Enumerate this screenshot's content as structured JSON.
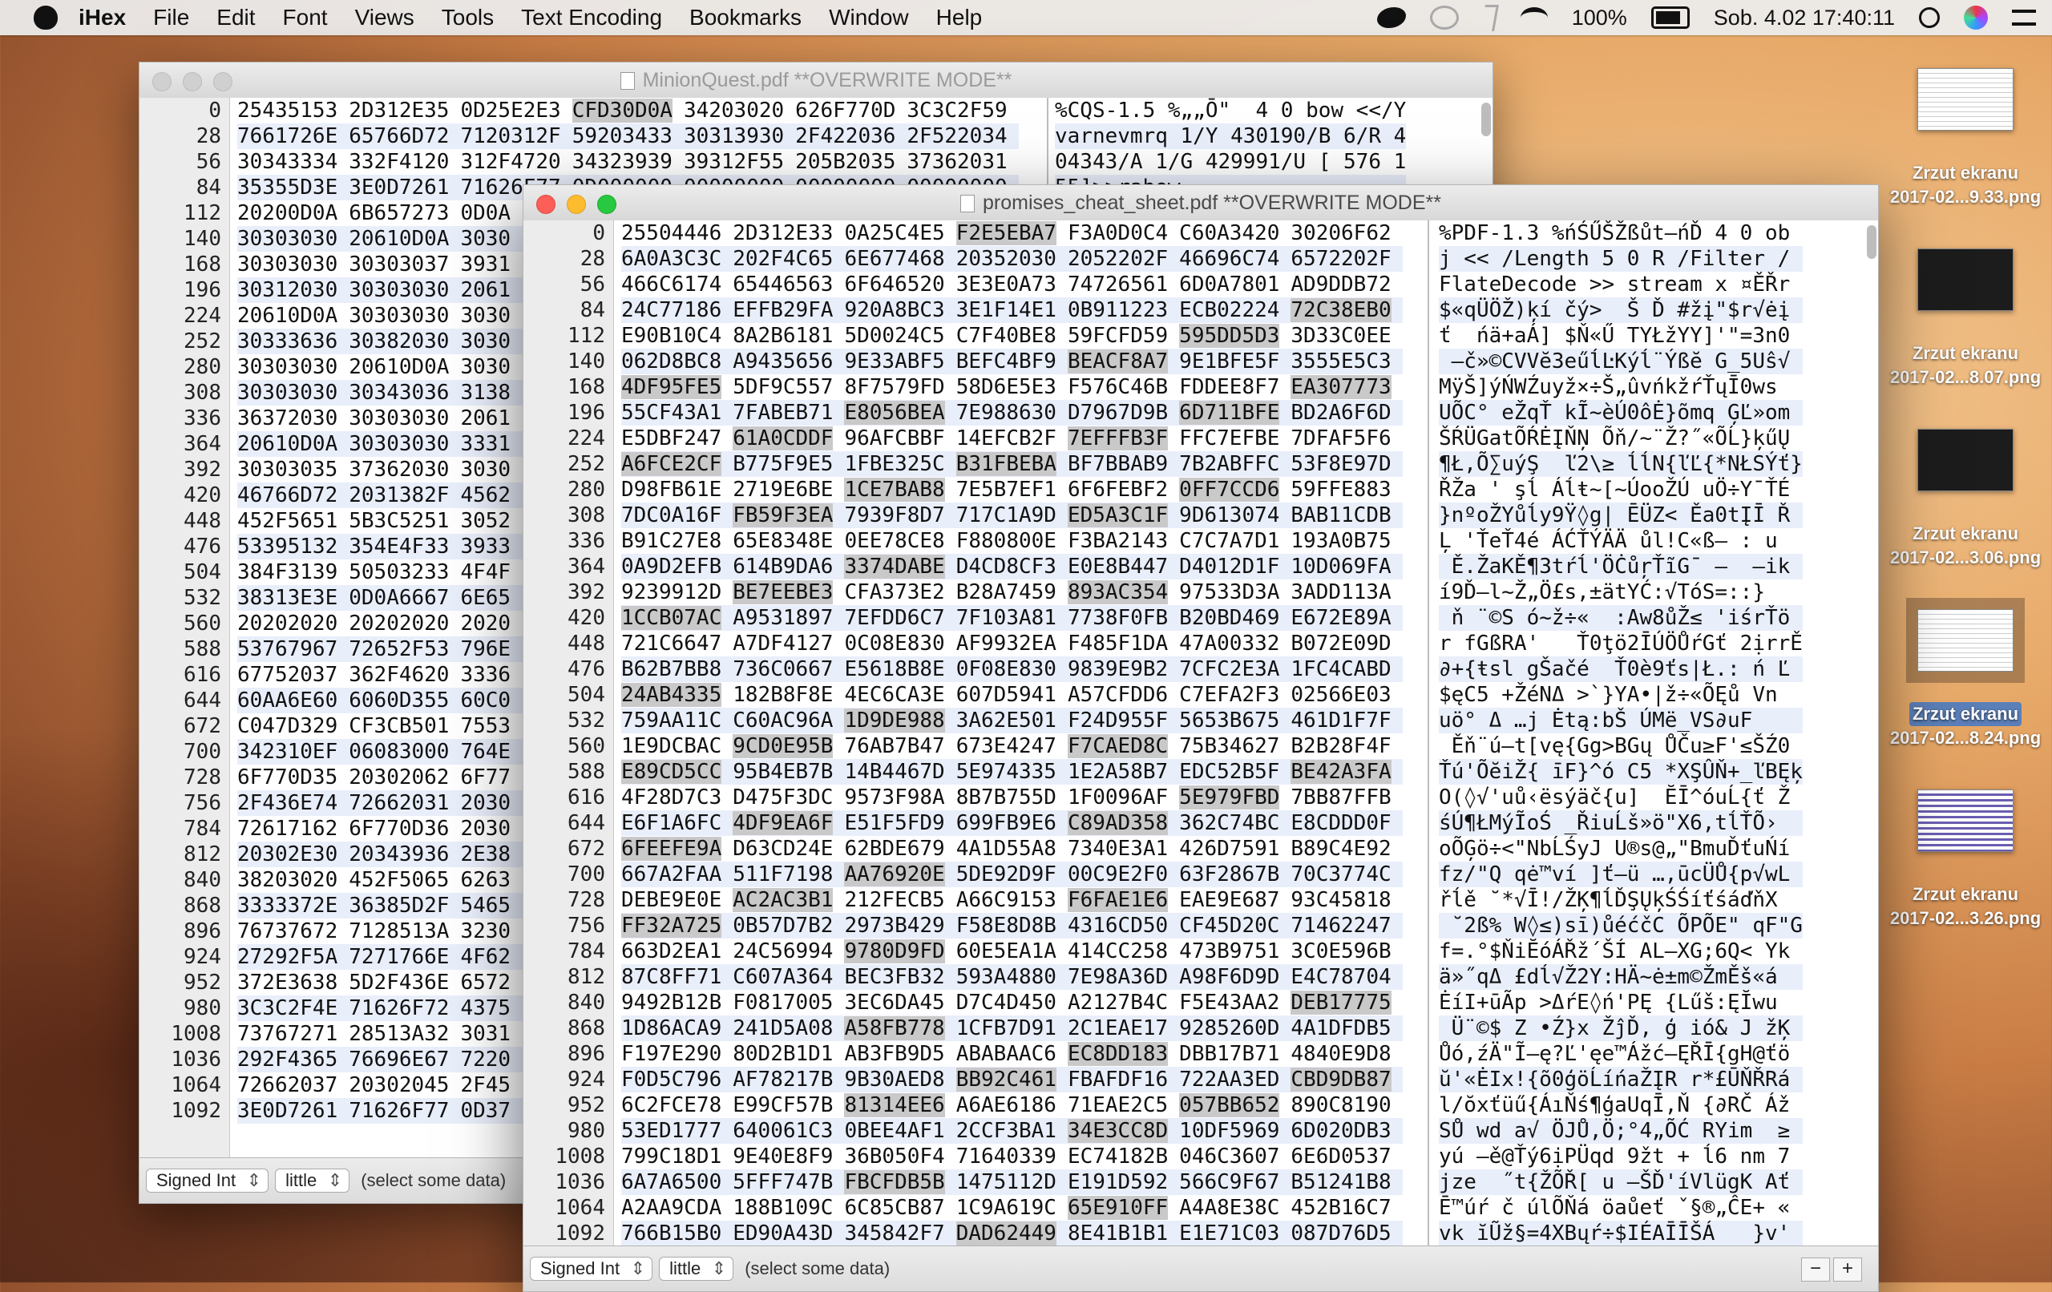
{
  "menubar": {
    "app": "iHex",
    "items": [
      "File",
      "Edit",
      "Font",
      "Views",
      "Tools",
      "Text Encoding",
      "Bookmarks",
      "Window",
      "Help"
    ],
    "battery": "100%",
    "clock": "Sob. 4.02  17:40:11"
  },
  "back_window": {
    "title": "MinionQuest.pdf **OVERWRITE MODE**",
    "offsets": [
      "0",
      "28",
      "56",
      "84",
      "112",
      "140",
      "168",
      "196",
      "224",
      "252",
      "280",
      "308",
      "336",
      "364",
      "392",
      "420",
      "448",
      "476",
      "504",
      "532",
      "560",
      "588",
      "616",
      "644",
      "672",
      "700",
      "728",
      "756",
      "784",
      "812",
      "840",
      "868",
      "896",
      "924",
      "952",
      "980",
      "1008",
      "1036",
      "1064",
      "1092"
    ],
    "hex_rows": [
      "25435153 2D312E35 0D25E2E3 CFD30D0A 34203020 626F770D 3C3C2F59",
      "7661726E 65766D72 7120312F 59203433 30313930 2F422036 2F522034",
      "30343334 332F4120 312F4720 34323939 39312F55 205B2035 37362031",
      "35355D3E 3E0D7261 71626F77 0D000000 00000000 00000000 00000000",
      "20200D0A 6B657273 0D0A",
      "30303030 20610D0A 3030",
      "30303030 30303037 3931",
      "30312030 30303030 2061",
      "20610D0A 30303030 3030",
      "30333636 30382030 3030",
      "30303030 20610D0A 3030",
      "30303030 30343036 3138",
      "36372030 30303030 2061",
      "20610D0A 30303030 3331",
      "30303035 37362030 3030",
      "46766D72 2031382F 4562",
      "452F5651 5B3C5251 3052",
      "53395132 354E4F33 3933",
      "384F3139 50503233 4F4F",
      "38313E3E 0D0A6667 6E65",
      "20202020 20202020 2020",
      "53767967 72652F53 796E",
      "67752037 362F4620 3336",
      "60AA6E60 6060D355 60C0",
      "C047D329 CF3CB501 7553",
      "342310EF 06083000 764E",
      "6F770D35 20302062 6F77",
      "2F436E74 72662031 2030",
      "72617162 6F770D36 2030",
      "20302E30 20343936 2E38",
      "38203020 452F5065 6263",
      "3333372E 36385D2F 5465",
      "76737672 7128513A 3230",
      "27292F5A 7271766E 4F62",
      "372E3638 5D2F436E 6572",
      "3C3C2F4E 71626F72 4375",
      "73767271 28513A32 3031",
      "292F4365 76696E67 7220",
      "72662037 20302045 2F45",
      "3E0D7261 71626F77 0D37"
    ],
    "text_rows": [
      "%CQS-1.5 %„„Ō\"  4 0 bow <</Y",
      "varnevmrq 1/Y 430190/B 6/R 4",
      "04343/A 1/G 429991/U [ 576 1",
      "55]>>rabow"
    ],
    "type_popup": "Signed Int",
    "endian_popup": "little",
    "status": "(select some data)"
  },
  "front_window": {
    "title": "promises_cheat_sheet.pdf **OVERWRITE MODE**",
    "offsets": [
      "0",
      "28",
      "56",
      "84",
      "112",
      "140",
      "168",
      "196",
      "224",
      "252",
      "280",
      "308",
      "336",
      "364",
      "392",
      "420",
      "448",
      "476",
      "504",
      "532",
      "560",
      "588",
      "616",
      "644",
      "672",
      "700",
      "728",
      "756",
      "784",
      "812",
      "840",
      "868",
      "896",
      "924",
      "952",
      "980",
      "1008",
      "1036",
      "1064",
      "1092"
    ],
    "hex_rows": [
      "25504446 2D312E33 0A25C4E5 F2E5EBA7 F3A0D0C4 C60A3420 30206F62",
      "6A0A3C3C 202F4C65 6E677468 20352030 2052202F 46696C74 6572202F",
      "466C6174 65446563 6F646520 3E3E0A73 74726561 6D0A7801 AD9DDB72",
      "24C77186 EFFB29FA 920A8BC3 3E1F14E1 0B911223 ECB02224 72C38EB0",
      "E90B10C4 8A2B6181 5D0024C5 C7F40BE8 59FCFD59 595DD5D3 3D33C0EE",
      "062D8BC8 A9435656 9E33ABF5 BEFC4BF9 BEACF8A7 9E1BFE5F 3555E5C3",
      "4DF95FE5 5DF9C557 8F7579FD 58D6E5E3 F576C46B FDDEE8F7 EA307773",
      "55CF43A1 7FABEB71 E8056BEA 7E988630 D7967D9B 6D711BFE BD2A6F6D",
      "E5DBF247 61A0CDDF 96AFCBBF 14EFCB2F 7EFFFB3F FFC7EFBE 7DFAF5F6",
      "A6FCE2CF B775F9E5 1FBE325C B31FBEBA BF7BBAB9 7B2ABFFC 53F8E97D",
      "D98FB61E 2719E6BE 1CE7BAB8 7E5B7EF1 6F6FEBF2 0FF7CCD6 59FFE883",
      "7DC0A16F FB59F3EA 7939F8D7 717C1A9D ED5A3C1F 9D613074 BAB11CDB",
      "B91C27E8 65E8348E 0EE78CE8 F880800E F3BA2143 C7C7A7D1 193A0B75",
      "0A9D2EFB 614B9DA6 3374DABE D4CD8CF3 E0E8B447 D4012D1F 10D069FA",
      "9239912D BE7EEBE3 CFA373E2 B28A7459 893AC354 97533D3A 3ADD113A",
      "1CCB07AC A9531897 7EFDD6C7 7F103A81 7738F0FB B20BD469 E672E89A",
      "721C6647 A7DF4127 0C08E830 AF9932EA F485F1DA 47A00332 B072E09D",
      "B62B7BB8 736C0667 E5618B8E 0F08E830 9839E9B2 7CFC2E3A 1FC4CABD",
      "24AB4335 182B8F8E 4EC6CA3E 607D5941 A57CFDD6 C7EFA2F3 02566E03",
      "759AA11C C60AC96A 1D9DE988 3A62E501 F24D955F 5653B675 461D1F7F",
      "1E9DCBAC 9CD0E95B 76AB7B47 673E4247 F7CAED8C 75B34627 B2B28F4F",
      "E89CD5CC 95B4EB7B 14B4467D 5E974335 1E2A58B7 EDC52B5F BE42A3FA",
      "4F28D7C3 D475F3DC 9573F98A 8B7B755D 1F0096AF 5E979FBD 7BB87FFB",
      "E6F1A6FC 4DF9EA6F E51F5FD9 699FB9E6 C89AD358 362C74BC E8CDDD0F",
      "6FEEFE9A D63CD24E 62BDE679 4A1D55A8 7340E3A1 426D7591 B89C4E92",
      "667A2FAA 511F7198 AA76920E 5DE92D9F 00C9E2F0 63F2867B 70C3774C",
      "DEBE9E0E AC2AC3B1 212FECB5 A66C9153 F6FAE1E6 EAE9E687 93C45818",
      "FF32A725 0B57D7B2 2973B429 F58E8D8B 4316CD50 CF45D20C 71462247",
      "663D2EA1 24C56994 9780D9FD 60E5EA1A 414CC258 473B9751 3C0E596B",
      "87C8FF71 C607A364 BEC3FB32 593A4880 7E98A36D A98F6D9D E4C78704",
      "9492B12B F0817005 3EC6DA45 D7C4D450 A2127B4C F5E43AA2 DEB17775",
      "1D86ACA9 241D5A08 A58FB778 1CFB7D91 2C1EAE17 9285260D 4A1DFDB5",
      "F197E290 80D2B1D1 AB3FB9D5 ABABAAC6 EC8DD183 DBB17B71 4840E9D8",
      "F0D5C796 AF78217B 9B30AED8 BB92C461 FBAFDF16 722AA3ED CBD9DB87",
      "6C2FCE78 E99CF57B 81314EE6 A6AE6186 71EAE2C5 057BB652 890C8190",
      "53ED1777 640061C3 0BEE4AF1 2CCF3BA1 34E3CC8D 10DF5969 6D020DB3",
      "799C18D1 9E40E8F9 36B050F4 71640339 EC74182B 046C3607 6E6D0537",
      "6A7A6500 5FFF747B FBCFDB5B 1475112D E191D592 566C9F67 B51241B8",
      "A2AA9CDA 188B109C 6C85CB87 1C9A619C 65E910FF A4A8E38C 452B16C7",
      "766B15B0 ED90A43D 345842F7 DAD62449 8E41B1B1 E1E71C03 087D76D5"
    ],
    "text_rows": [
      "%PDF-1.3 %ńŚŰŠŽßůt–ńĎ 4 0 ob",
      "j << /Length 5 0 R /Filter /",
      "FlateDecode >> stream x ¤ĚŘr",
      "$«qÜÖŽ)ķí čý>  Š Ď #žį\"$r√ėį",
      "ť  ńä+aÁ] $Ň«Ű TYŁžYY]'\"=3n0",
      " –č»©CVVĕ3eűĺĿKýĺ¨Ýßĕ G_5Uŝ√",
      "MÿŠ]ýŃWŹuyž×÷Š„ûvńkžŕŤųĪ0ws",
      "UÕC° eŽqŤ kĨ~èÚ0ôĖ}õmq ĢĽ»om",
      "ŠŔÜGatÕŔĖĮŇŅ Õň/~¨Ž?˝«ÕĹ}ķűŲ",
      "¶Ł,Õ∑uýŞ  ľ2\\≥ ĺĺN{ľĽ{*NŁSÝť}",
      "ŘŽa ' şĺ Áĺŧ~[~ÚooŽÚ uÖ÷Y¯ŤÉ",
      "}nºoŽYůĺy9Ÿ◊g| ĒÜZ< Ěa0tĮĪ Ř",
      "Ļ 'ŤeŤ4é ÁĆŤÝÄÄ ůl!C«ß– : u",
      " Ě.ŽaKĚ¶3tŕĺ'ÖĊůŗŤĩG¯ –  –ik",
      "í9Ď–l~Ž„Ö£s,±ätYĆ:√TóS=::} ",
      " ň ¨©S ó~ž÷«  :Aw8ůŽ≤ 'iśrŤö",
      "r fGßRA'   Ť0ţö2ĪÚÖŮŕGť 2ịrrĚ",
      "∂+{ŧsl gŠačé  Ť0è9ťs|Ł.: ń Ľ",
      "$ęC5 +ŽéNΔ >`}YA•|ž÷«ÕĘů Vn",
      "uö° Δ …j Ėtą:bŠ ÚMë_VS∂uF",
      " Ěň¨ú–t[vę{Gg>BGų ŮČu≥F'≤ŠŹ0",
      "Ťú'ÕĕiŽ{ īF}^ó C5 *XŞÛŇ+_ľBĘķ",
      "O(◊√'uů‹ësýäč{u]  ĔĪ^óuĹ{ť Ž",
      "śÚ¶ŁMýĨoŚ _ŘiuĹš»ö\"X6,tĺŤÕ›",
      "oÕĢö÷<\"NbĹŚyJ U®s@„\"BmuĎťuŃí",
      "fz/\"Q qė™ví ]ť–ü …,ūcÜŮ{p√wL",
      "řĺě ˘*√Ī!/ŽĶ¶ĺĎŞŲķŚŚíťśáďňX",
      " ˘2ß% W◊≤)sī)ůéćčC ÕPÕE\" qF\"G",
      "f=.°$ŇiĔóÁŘž´ŠÍ AL–XG;6Q< Yk",
      "ä»˝qΔ £dĺ√Ž2Y:HÄ~ė±m©ŽmĚš«á",
      "ĖíI+ūÃp >ΔŕE◊ń'PĘ {Lűš:ĘĬwu",
      " Ü¨©$ Z •Ź}x ŽĵĎ, ģ ió& J žĶ",
      "Ůó,źÄ\"Ĩ–ę?Ľ'ęe™Ážć–ĘŘĪ{gH@ťö",
      "ŭ'«ĖIx!{õ0ģöĹíńaŽĮR r*£ŪŇŘRá",
      "l/ŏxťüű{ÁıŇś¶ģaUqĪ,Ň {∂RČ Áž",
      "SŮ wd a√ ÖJŮ,Ö;°4„ÕĆ RYim  ≥",
      "yú –ě@Ťý6ịPÜqd 9žt + ĺ6 nm 7",
      "jze  ˝t{ŽÕŘ[ u –ŠĎ'íVlügK Ať",
      "Ē™úŕ č úlÕŇá öaůeť ˇ§®„ĈE+ «",
      "vk ĭŨž§=4XBųŕ÷$IÉAĪĪŠÁ   }v'"
    ],
    "type_popup": "Signed Int",
    "endian_popup": "little",
    "status": "(select some data)"
  },
  "desktop_files": [
    {
      "label_1": "Zrzut ekranu",
      "label_2": "2017-02...9.33.png"
    },
    {
      "label_1": "Zrzut ekranu",
      "label_2": "2017-02...8.07.png"
    },
    {
      "label_1": "Zrzut ekranu",
      "label_2": "2017-02...3.06.png"
    },
    {
      "label_1": "Zrzut ekranu",
      "label_2": "2017-02...8.24.png"
    },
    {
      "label_1": "Zrzut ekranu",
      "label_2": "2017-02...3.26.png"
    }
  ]
}
